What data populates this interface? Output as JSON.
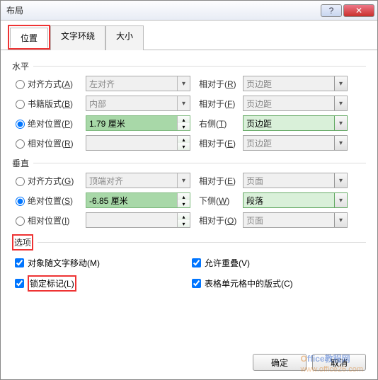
{
  "title": "布局",
  "tabs": {
    "position": "位置",
    "wrap": "文字环绕",
    "size": "大小"
  },
  "horizontal": {
    "heading": "水平",
    "align": {
      "label": "对齐方式(",
      "key": "A",
      "tail": ")",
      "value": "左对齐",
      "rel_label": "相对于(",
      "rel_key": "R",
      "rel_tail": ")",
      "rel_value": "页边距"
    },
    "book": {
      "label": "书籍版式(",
      "key": "B",
      "tail": ")",
      "value": "内部",
      "rel_label": "相对于(",
      "rel_key": "F",
      "rel_tail": ")",
      "rel_value": "页边距"
    },
    "abs": {
      "label": "绝对位置(",
      "key": "P",
      "tail": ")",
      "value": "1.79 厘米",
      "rel_label": "右侧(",
      "rel_key": "T",
      "rel_tail": ")",
      "rel_value": "页边距"
    },
    "rel": {
      "label": "相对位置(",
      "key": "R",
      "tail": ")",
      "value": "",
      "rel_label": "相对于(",
      "rel_key": "E",
      "rel_tail": ")",
      "rel_value": "页边距"
    }
  },
  "vertical": {
    "heading": "垂直",
    "align": {
      "label": "对齐方式(",
      "key": "G",
      "tail": ")",
      "value": "顶端对齐",
      "rel_label": "相对于(",
      "rel_key": "E",
      "rel_tail": ")",
      "rel_value": "页面"
    },
    "abs": {
      "label": "绝对位置(",
      "key": "S",
      "tail": ")",
      "value": "-6.85 厘米",
      "rel_label": "下侧(",
      "rel_key": "W",
      "rel_tail": ")",
      "rel_value": "段落"
    },
    "rel": {
      "label": "相对位置(",
      "key": "I",
      "tail": ")",
      "value": "",
      "rel_label": "相对于(",
      "rel_key": "O",
      "rel_tail": ")",
      "rel_value": "页面"
    }
  },
  "options": {
    "heading": "选项",
    "move_with_text": {
      "label": "对象随文字移动(",
      "key": "M",
      "tail": ")"
    },
    "lock_anchor": {
      "label": "锁定标记(",
      "key": "L",
      "tail": ")"
    },
    "allow_overlap": {
      "label": "允许重叠(",
      "key": "V",
      "tail": ")"
    },
    "table_cell": {
      "label": "表格单元格中的版式(",
      "key": "C",
      "tail": ")"
    }
  },
  "buttons": {
    "ok": "确定",
    "cancel": "取消"
  },
  "watermark": {
    "brand1": "O",
    "brand2": "ffice教程网",
    "url": "www.office26.com"
  }
}
